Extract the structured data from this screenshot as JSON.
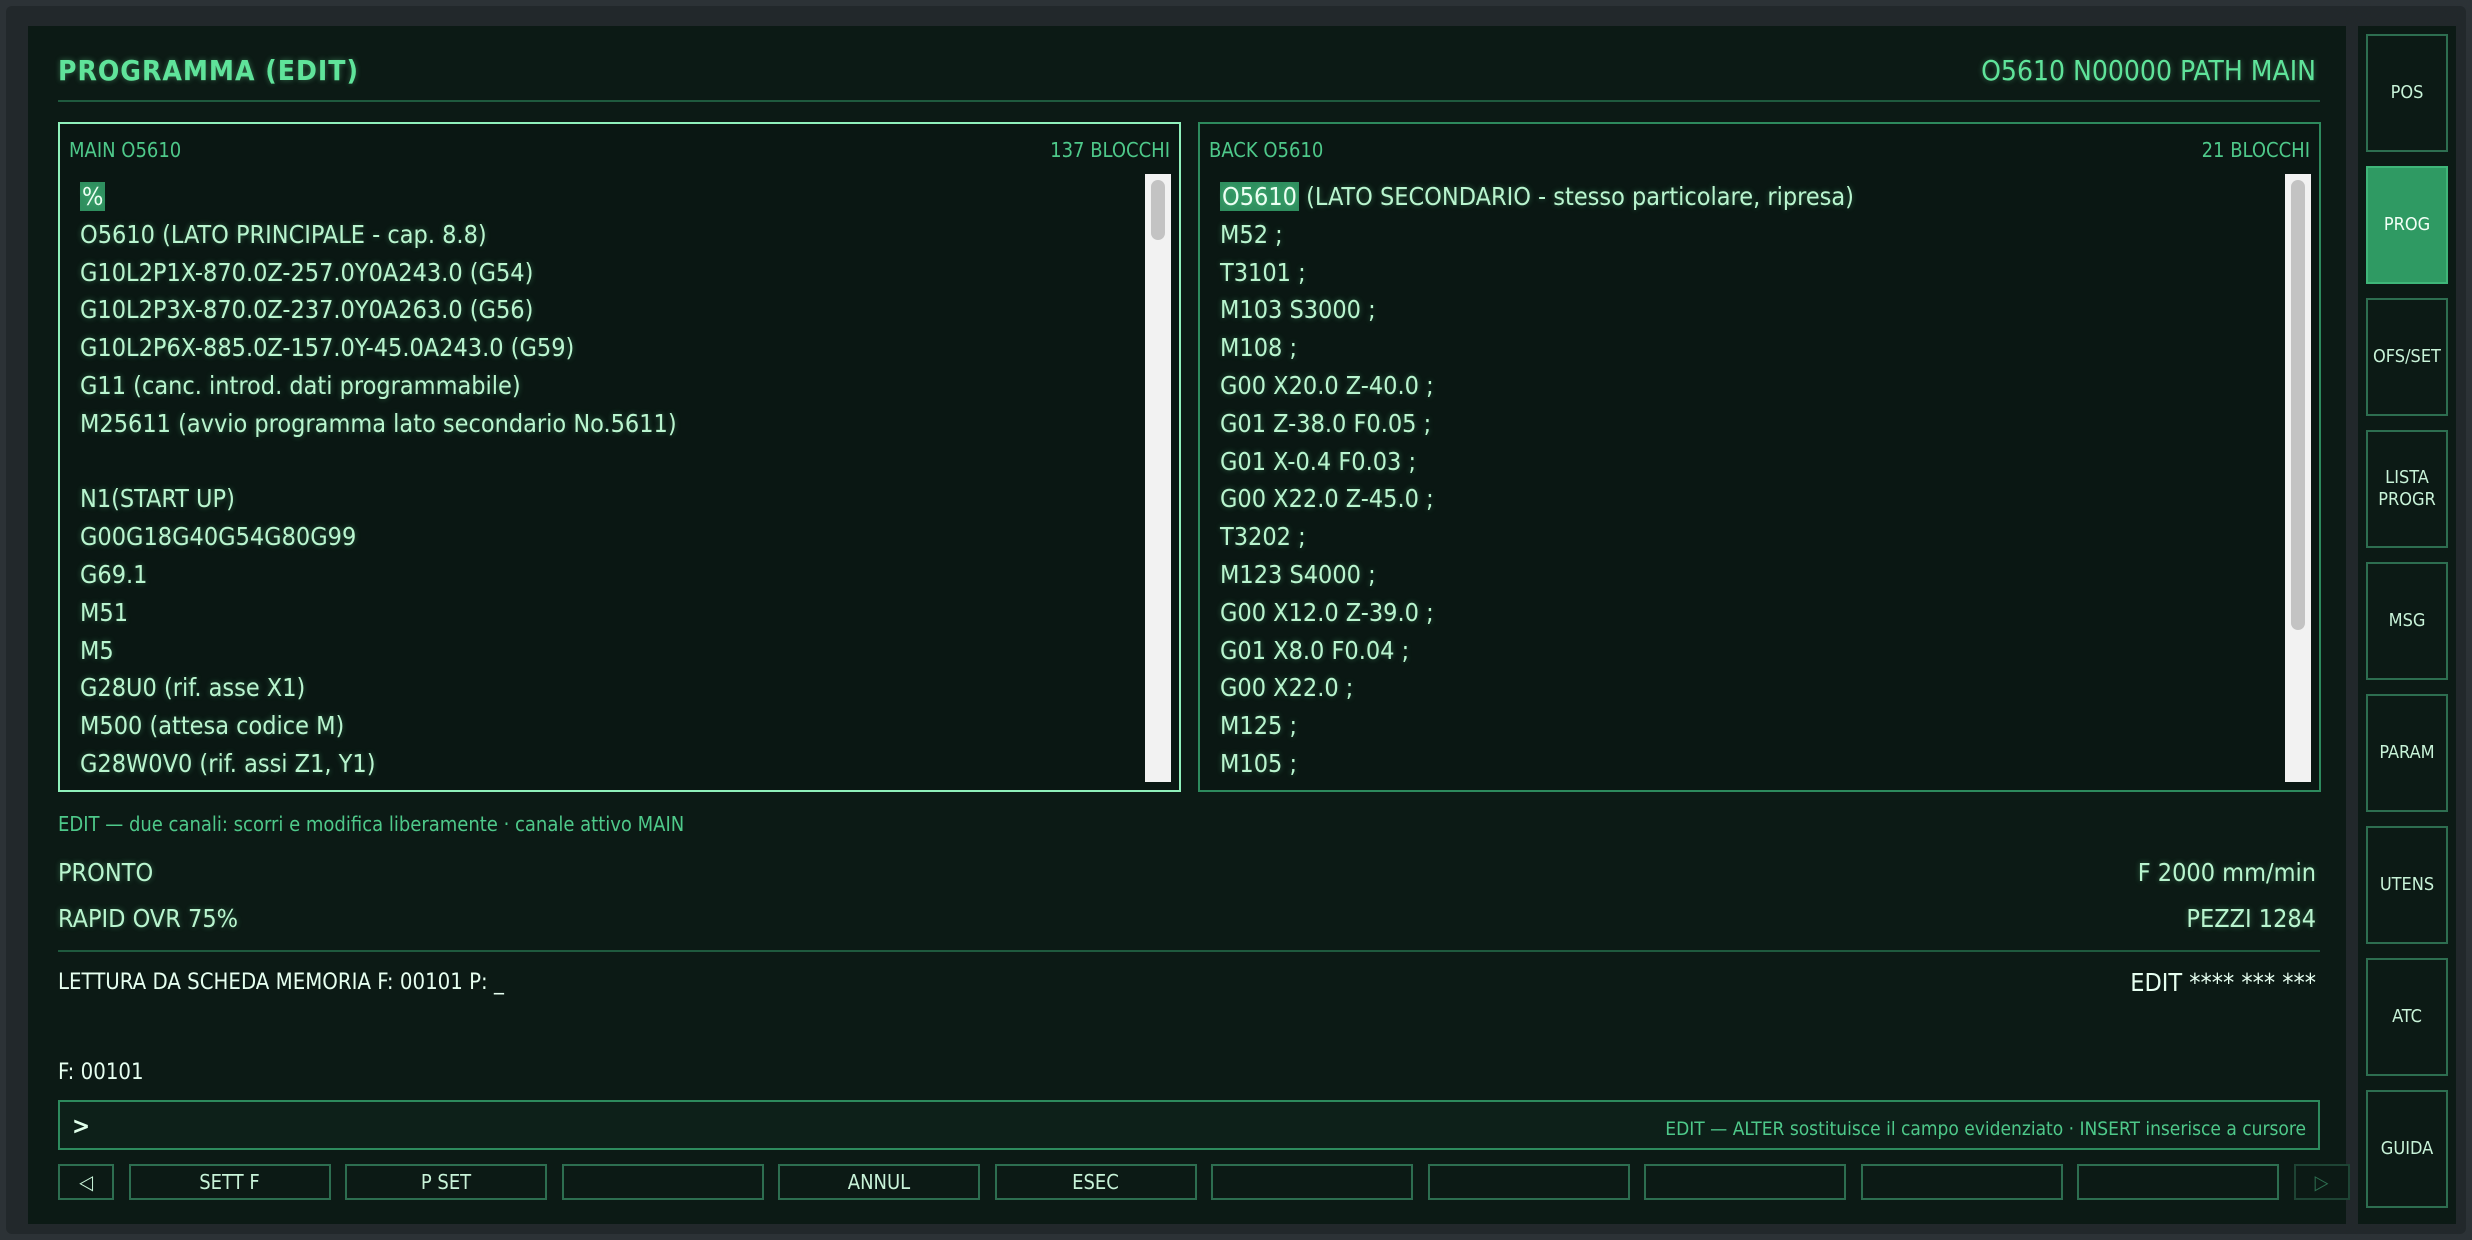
{
  "header": {
    "title": "PROGRAMMA (EDIT)",
    "status": "O5610 N00000 PATH MAIN"
  },
  "main_pane": {
    "label": "MAIN O5610",
    "blocks": "137 BLOCCHI",
    "lines": [
      "%",
      "O5610 (LATO PRINCIPALE - cap. 8.8)",
      "G10L2P1X-870.0Z-257.0Y0A243.0 (G54)",
      "G10L2P3X-870.0Z-237.0Y0A263.0 (G56)",
      "G10L2P6X-885.0Z-157.0Y-45.0A243.0 (G59)",
      "G11 (canc. introd. dati programmabile)",
      "M25611 (avvio programma lato secondario No.5611)",
      "",
      "N1(START UP)",
      "G00G18G40G54G80G99",
      "G69.1",
      "M51",
      "M5",
      "G28U0 (rif. asse X1)",
      "M500 (attesa codice M)",
      "G28W0V0 (rif. assi Z1, Y1)"
    ],
    "scroll_position": 0.0
  },
  "back_pane": {
    "label": "BACK O5610",
    "blocks": "21 BLOCCHI",
    "first_token": "O5610",
    "first_rest": " (LATO SECONDARIO - stesso particolare, ripresa)",
    "lines": [
      "M52 ;",
      "T3101 ;",
      "M103 S3000 ;",
      "M108 ;",
      "G00 X20.0 Z-40.0 ;",
      "G01 Z-38.0 F0.05 ;",
      "G01 X-0.4 F0.03 ;",
      "G00 X22.0 Z-45.0 ;",
      "T3202 ;",
      "M123 S4000 ;",
      "G00 X12.0 Z-39.0 ;",
      "G01 X8.0 F0.04 ;",
      "G00 X22.0 ;",
      "M125 ;",
      "M105 ;"
    ],
    "scroll_position": 0.0
  },
  "hint": "EDIT — due canali: scorri e modifica liberamente · canale attivo MAIN",
  "status": {
    "state": "PRONTO",
    "feed": "F 2000 mm/min",
    "rapid": "RAPID OVR 75%",
    "parts": "PEZZI 1284"
  },
  "message": {
    "reading": "LETTURA DA SCHEDA MEMORIA F: 00101 P: _",
    "mode": "EDIT **** *** ***",
    "file": "F: 00101"
  },
  "command": {
    "prompt": ">",
    "hint": "EDIT — ALTER sostituisce il campo evidenziato · INSERT inserisce a cursore"
  },
  "softkeys": [
    "◁",
    "SETT F",
    "P SET",
    "",
    "ANNUL",
    "ESEC",
    "",
    "",
    "",
    "",
    "",
    "▷"
  ],
  "side_buttons": [
    {
      "label": "POS",
      "active": false
    },
    {
      "label": "PROG",
      "active": true
    },
    {
      "label": "OFS/SET",
      "active": false
    },
    {
      "label": "LISTA\nPROGR",
      "active": false
    },
    {
      "label": "MSG",
      "active": false
    },
    {
      "label": "PARAM",
      "active": false
    },
    {
      "label": "UTENS",
      "active": false
    },
    {
      "label": "ATC",
      "active": false
    },
    {
      "label": "GUIDA",
      "active": false
    }
  ]
}
